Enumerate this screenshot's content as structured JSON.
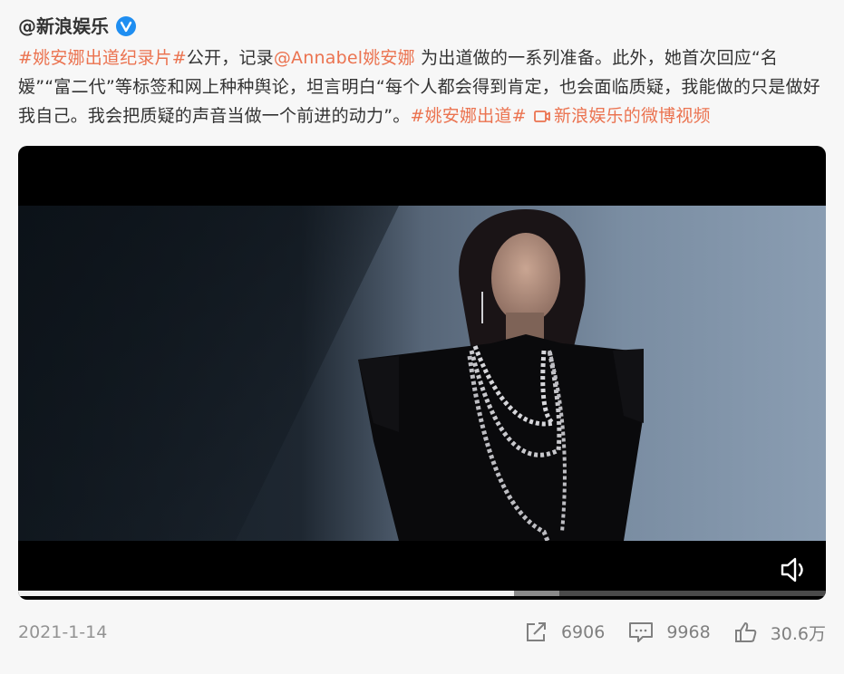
{
  "author": {
    "name": "@新浪娱乐"
  },
  "post": {
    "hashtag1": "#姚安娜出道纪录片#",
    "text1": "公开，记录",
    "mention": "@Annabel姚安娜",
    "text2": " 为出道做的一系列准备。此外，她首次回应“名媛”“富二代”等标签和网上种种舆论，坦言明白“每个人都会得到肯定，也会面临质疑，我能做的只是做好我自己。我会把质疑的声音当做一个前进的动力”。",
    "hashtag2": "#姚安娜出道#",
    "video_link": "新浪娱乐的微博视频"
  },
  "video": {
    "progress_fraction": 0.614,
    "buffered_fraction": 0.67
  },
  "footer": {
    "date": "2021-1-14",
    "reposts": "6906",
    "comments": "9968",
    "likes": "30.6万"
  },
  "colors": {
    "link": "#eb7350",
    "verified": "#1f8ef1"
  }
}
